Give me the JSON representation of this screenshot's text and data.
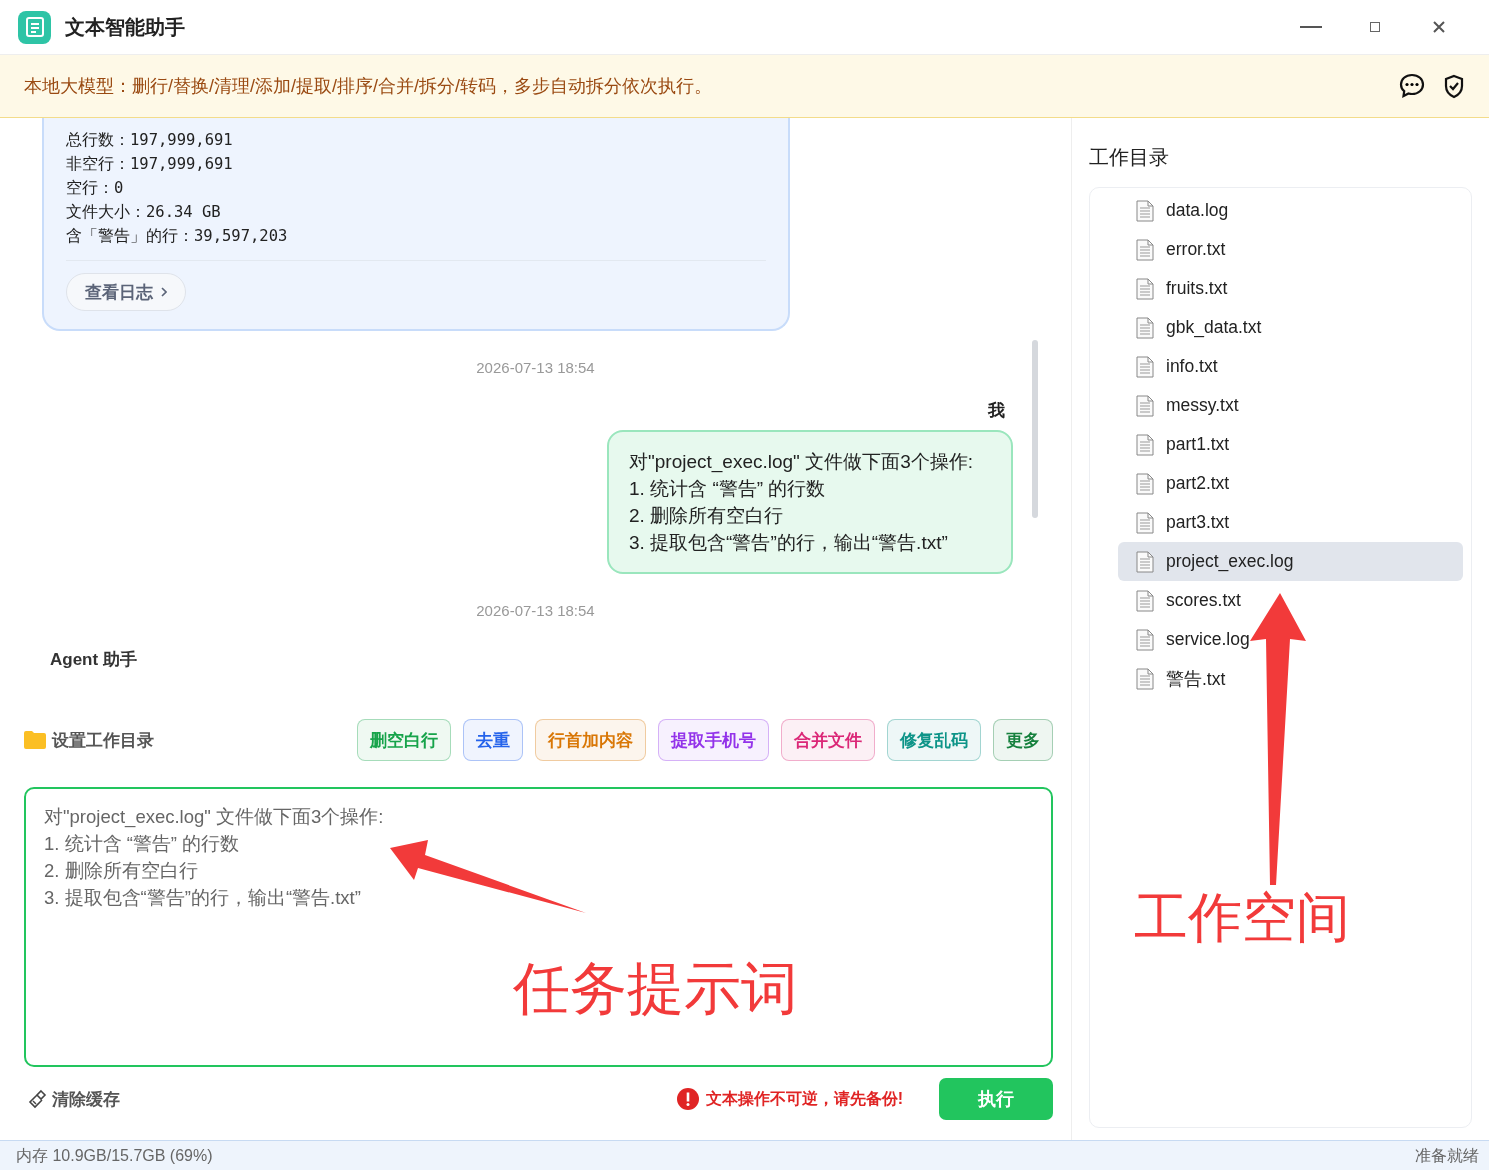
{
  "window": {
    "title": "文本智能助手"
  },
  "banner": {
    "text": "本地大模型：删行/替换/清理/添加/提取/排序/合并/拆分/转码，多步自动拆分依次执行。"
  },
  "chat": {
    "messages": [
      {
        "kind": "result",
        "lines": [
          "总行数：197,999,691",
          "非空行：197,999,691",
          "空行：0",
          "文件大小：26.34 GB",
          "含「警告」的行：39,597,203"
        ],
        "button": "查看日志"
      },
      {
        "kind": "timestamp",
        "text": "2026-07-13 18:54"
      },
      {
        "kind": "user",
        "sender": "我",
        "lines": [
          "对\"project_exec.log\" 文件做下面3个操作:",
          "1. 统计含 “警告” 的行数",
          "2. 删除所有空白行",
          "3. 提取包含“警告”的行，输出“警告.txt”"
        ]
      },
      {
        "kind": "timestamp",
        "text": "2026-07-13 18:54"
      },
      {
        "kind": "agent",
        "sender": "Agent 助手"
      }
    ]
  },
  "composer": {
    "set_dir": "设置工作目录",
    "chips": [
      {
        "label": "删空白行",
        "color": "#16a34a"
      },
      {
        "label": "去重",
        "color": "#2563eb"
      },
      {
        "label": "行首加内容",
        "color": "#d97706"
      },
      {
        "label": "提取手机号",
        "color": "#9333ea"
      },
      {
        "label": "合并文件",
        "color": "#db2777"
      },
      {
        "label": "修复乱码",
        "color": "#0d9488"
      },
      {
        "label": "更多",
        "color": "#15803d"
      }
    ],
    "input": {
      "value": "对\"project_exec.log\" 文件做下面3个操作:\n1. 统计含 “警告” 的行数\n2. 删除所有空白行\n3. 提取包含“警告”的行，输出“警告.txt”"
    },
    "clear": "清除缓存",
    "warning": "文本操作不可逆，请先备份!",
    "run": "执行"
  },
  "sidebar": {
    "title": "工作目录",
    "files": [
      {
        "name": "data.log",
        "selected": false
      },
      {
        "name": "error.txt",
        "selected": false
      },
      {
        "name": "fruits.txt",
        "selected": false
      },
      {
        "name": "gbk_data.txt",
        "selected": false
      },
      {
        "name": "info.txt",
        "selected": false
      },
      {
        "name": "messy.txt",
        "selected": false
      },
      {
        "name": "part1.txt",
        "selected": false
      },
      {
        "name": "part2.txt",
        "selected": false
      },
      {
        "name": "part3.txt",
        "selected": false
      },
      {
        "name": "project_exec.log",
        "selected": true
      },
      {
        "name": "scores.txt",
        "selected": false
      },
      {
        "name": "service.log",
        "selected": false
      },
      {
        "name": "警告.txt",
        "selected": false
      }
    ]
  },
  "status_bar": {
    "memory": "内存 10.9GB/15.7GB (69%)",
    "state": "准备就绪"
  },
  "annotations": [
    {
      "kind": "left-arrow",
      "text": "任务提示词"
    },
    {
      "kind": "up-arrow",
      "text": "工作空间"
    }
  ]
}
